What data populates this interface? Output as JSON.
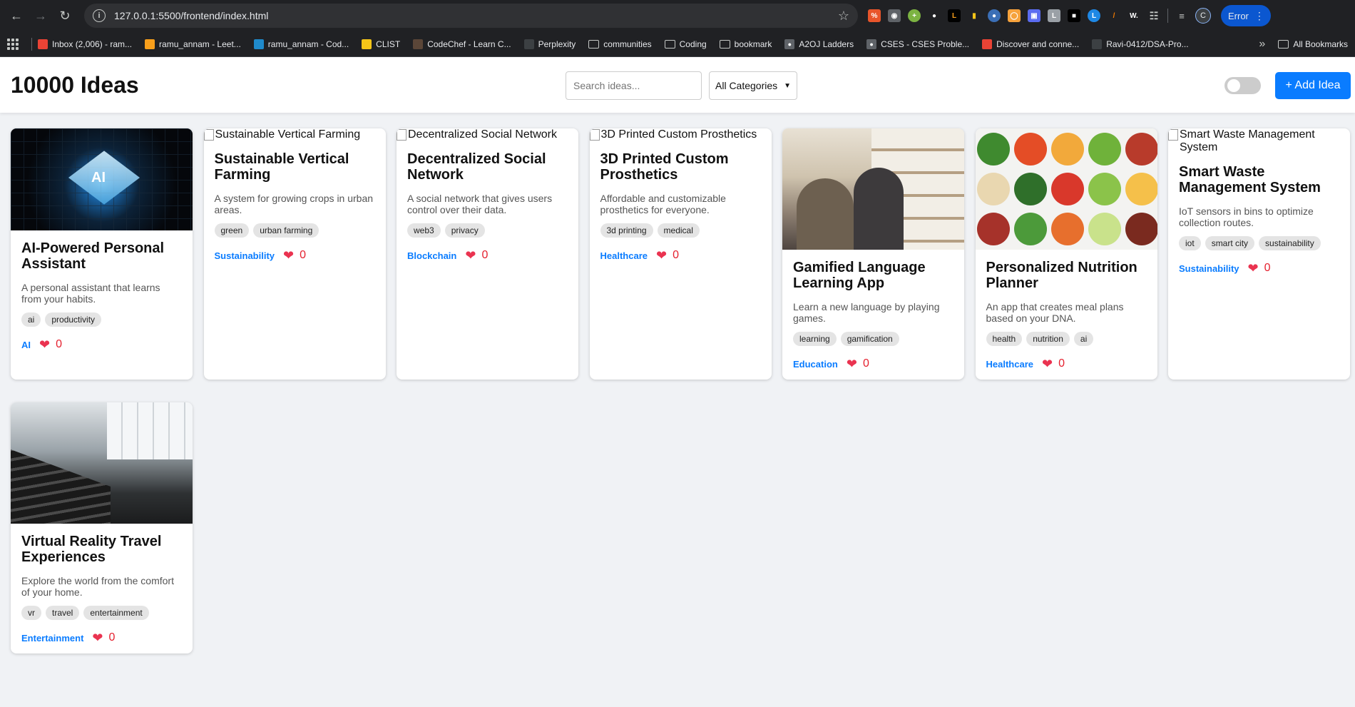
{
  "browser": {
    "url": "127.0.0.1:5500/frontend/index.html",
    "profile_initial": "C",
    "error_label": "Error",
    "bookmarks": [
      {
        "label": "Inbox (2,006) - ram...",
        "icon": "gmail-icon",
        "color": "#ea4335"
      },
      {
        "label": "ramu_annam - Leet...",
        "icon": "leetcode-icon",
        "color": "#f89f1b"
      },
      {
        "label": "ramu_annam - Cod...",
        "icon": "codeforces-icon",
        "color": "#1f8acb"
      },
      {
        "label": "CLIST",
        "icon": "clist-icon",
        "color": "#f5c518"
      },
      {
        "label": "CodeChef - Learn C...",
        "icon": "codechef-icon",
        "color": "#5b4638"
      },
      {
        "label": "Perplexity",
        "icon": "perplexity-icon",
        "color": "#3c4043"
      },
      {
        "label": "communities",
        "icon": "folder-icon",
        "color": ""
      },
      {
        "label": "Coding",
        "icon": "folder-icon",
        "color": ""
      },
      {
        "label": "bookmark",
        "icon": "folder-icon",
        "color": ""
      },
      {
        "label": "A2OJ Ladders",
        "icon": "globe-icon",
        "color": "#5f6368"
      },
      {
        "label": "CSES - CSES Proble...",
        "icon": "globe-icon",
        "color": "#5f6368"
      },
      {
        "label": "Discover and conne...",
        "icon": "discover-icon",
        "color": "#ea4335"
      },
      {
        "label": "Ravi-0412/DSA-Pro...",
        "icon": "github-icon",
        "color": "#3c4043"
      }
    ],
    "all_bookmarks": "All Bookmarks"
  },
  "header": {
    "title": "10000 Ideas",
    "search_placeholder": "Search ideas...",
    "category_selected": "All Categories",
    "add_button": "+ Add Idea"
  },
  "ideas": [
    {
      "title": "AI-Powered Personal Assistant",
      "description": "A personal assistant that learns from your habits.",
      "tags": [
        "ai",
        "productivity"
      ],
      "category": "AI",
      "likes": "0",
      "image": "ai",
      "alt": ""
    },
    {
      "title": "Sustainable Vertical Farming",
      "description": "A system for growing crops in urban areas.",
      "tags": [
        "green",
        "urban farming"
      ],
      "category": "Sustainability",
      "likes": "0",
      "image": "broken",
      "alt": "Sustainable Vertical Farming"
    },
    {
      "title": "Decentralized Social Network",
      "description": "A social network that gives users control over their data.",
      "tags": [
        "web3",
        "privacy"
      ],
      "category": "Blockchain",
      "likes": "0",
      "image": "broken",
      "alt": "Decentralized Social Network"
    },
    {
      "title": "3D Printed Custom Prosthetics",
      "description": "Affordable and customizable prosthetics for everyone.",
      "tags": [
        "3d printing",
        "medical"
      ],
      "category": "Healthcare",
      "likes": "0",
      "image": "broken",
      "alt": "3D Printed Custom Prosthetics"
    },
    {
      "title": "Gamified Language Learning App",
      "description": "Learn a new language by playing games.",
      "tags": [
        "learning",
        "gamification"
      ],
      "category": "Education",
      "likes": "0",
      "image": "lang",
      "alt": ""
    },
    {
      "title": "Personalized Nutrition Planner",
      "description": "An app that creates meal plans based on your DNA.",
      "tags": [
        "health",
        "nutrition",
        "ai"
      ],
      "category": "Healthcare",
      "likes": "0",
      "image": "food",
      "alt": ""
    },
    {
      "title": "Smart Waste Management System",
      "description": "IoT sensors in bins to optimize collection routes.",
      "tags": [
        "iot",
        "smart city",
        "sustainability"
      ],
      "category": "Sustainability",
      "likes": "0",
      "image": "broken",
      "alt": "Smart Waste Management System"
    },
    {
      "title": "Virtual Reality Travel Experiences",
      "description": "Explore the world from the comfort of your home.",
      "tags": [
        "vr",
        "travel",
        "entertainment"
      ],
      "category": "Entertainment",
      "likes": "0",
      "image": "gym",
      "alt": ""
    }
  ]
}
